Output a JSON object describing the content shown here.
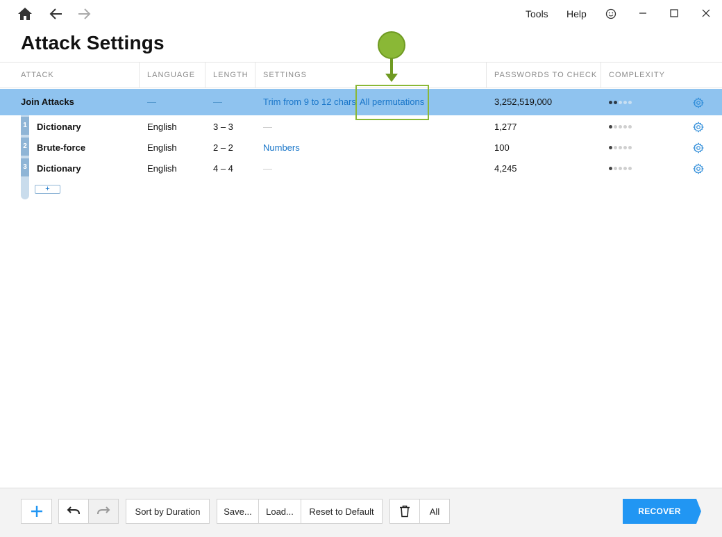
{
  "titlebar": {
    "menu_tools": "Tools",
    "menu_help": "Help"
  },
  "page": {
    "title": "Attack Settings"
  },
  "table": {
    "headers": [
      "ATTACK",
      "LANGUAGE",
      "LENGTH",
      "SETTINGS",
      "PASSWORDS TO CHECK",
      "COMPLEXITY"
    ],
    "join_row": {
      "name": "Join Attacks",
      "language": "—",
      "length": "—",
      "setting_trim": "Trim from 9 to 12 chars",
      "setting_perm": "All permutations",
      "passwords": "3,252,519,000",
      "complexity": 2
    },
    "sub_rows": [
      {
        "index": "1",
        "name": "Dictionary",
        "language": "English",
        "length": "3 – 3",
        "settings": "—",
        "passwords": "1,277",
        "complexity": 1
      },
      {
        "index": "2",
        "name": "Brute-force",
        "language": "English",
        "length": "2 – 2",
        "settings": "Numbers",
        "passwords": "100",
        "complexity": 1
      },
      {
        "index": "3",
        "name": "Dictionary",
        "language": "English",
        "length": "4 – 4",
        "settings": "—",
        "passwords": "4,245",
        "complexity": 1
      }
    ],
    "add_label": "+"
  },
  "footer": {
    "add": "+",
    "sort": "Sort by Duration",
    "save": "Save...",
    "load": "Load...",
    "reset": "Reset to Default",
    "all": "All",
    "recover": "RECOVER"
  },
  "colors": {
    "accent": "#2196f3",
    "selected_row": "#8fc3ef",
    "link": "#1976c9",
    "callout": "#8ab836"
  }
}
